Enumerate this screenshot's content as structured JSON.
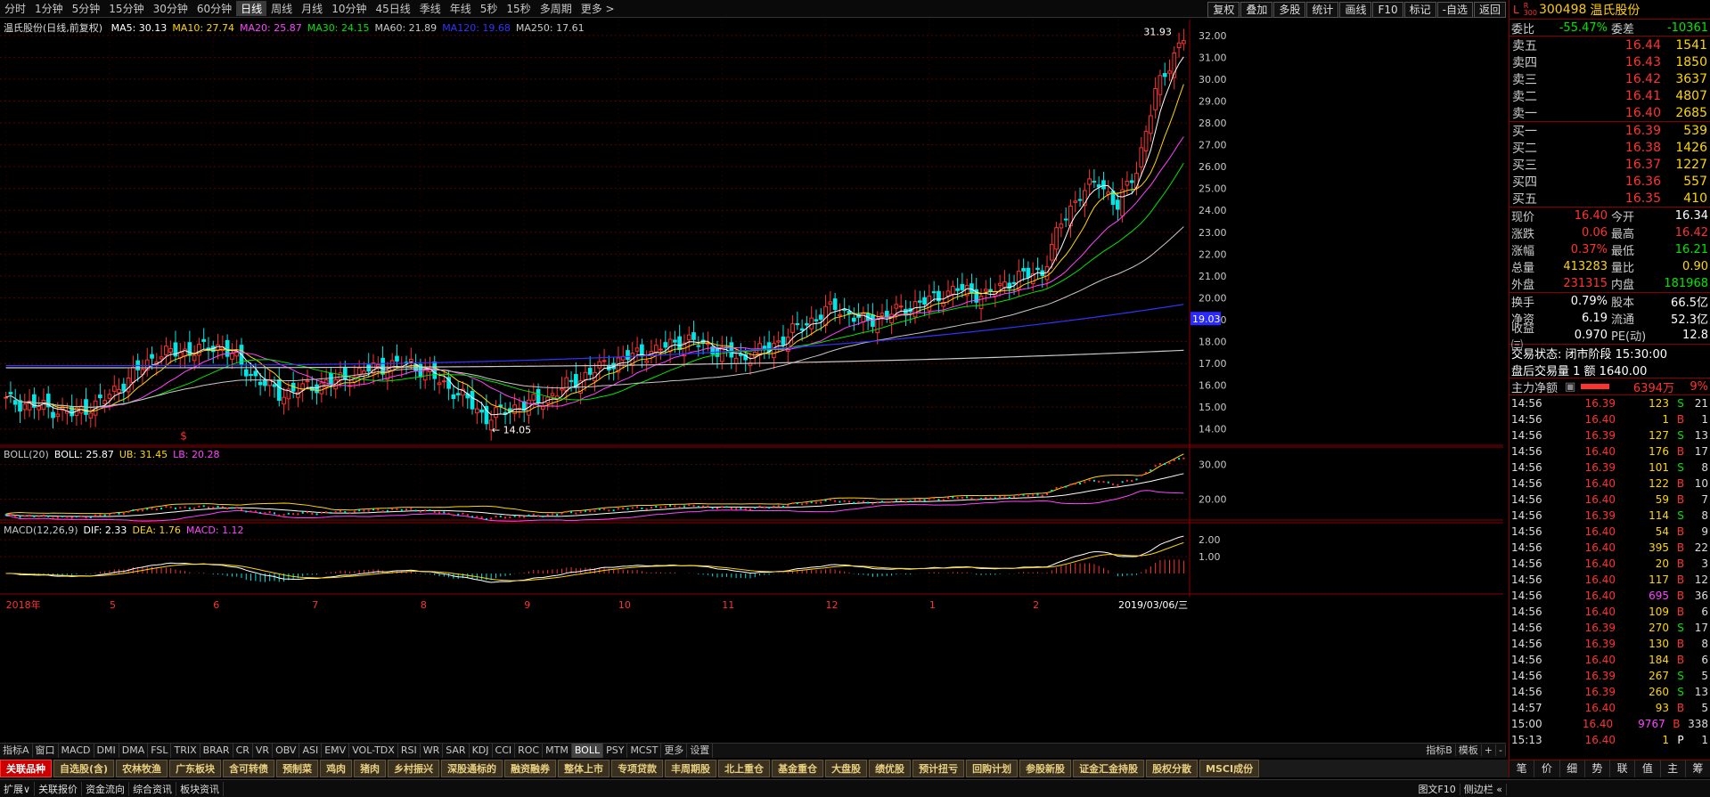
{
  "periods": [
    "分时",
    "1分钟",
    "5分钟",
    "15分钟",
    "30分钟",
    "60分钟",
    "日线",
    "周线",
    "月线",
    "10分钟",
    "45日线",
    "季线",
    "年线",
    "5秒",
    "15秒",
    "多周期",
    "更多 >"
  ],
  "active_period": "日线",
  "toolbar_right": [
    "复权",
    "叠加",
    "多股",
    "统计",
    "画线",
    "F10",
    "标记",
    "-自选",
    "返回"
  ],
  "stock": {
    "code": "300498",
    "name": "温氏股份",
    "market_badge_top": "R",
    "market_badge_bot": "300",
    "side_mark": "L"
  },
  "chart_title": "温氏股份(日线,前复权)",
  "ma_legend": [
    {
      "label": "MA5: 30.13",
      "color": "#ffffff"
    },
    {
      "label": "MA10: 27.74",
      "color": "#ffd700"
    },
    {
      "label": "MA20: 25.87",
      "color": "#ff44ff"
    },
    {
      "label": "MA30: 24.15",
      "color": "#00e600"
    },
    {
      "label": "MA60: 21.89",
      "color": "#c8c8c8"
    },
    {
      "label": "MA120: 19.68",
      "color": "#3333ff"
    },
    {
      "label": "MA250: 17.61",
      "color": "#c8c8c8"
    }
  ],
  "boll_legend": [
    {
      "label": "BOLL(20)",
      "color": "#c8c8c8"
    },
    {
      "label": "BOLL: 25.87",
      "color": "#ffffff"
    },
    {
      "label": "UB: 31.45",
      "color": "#ffd700"
    },
    {
      "label": "LB: 20.28",
      "color": "#ff44ff"
    }
  ],
  "macd_legend": [
    {
      "label": "MACD(12,26,9)",
      "color": "#c8c8c8"
    },
    {
      "label": "DIF: 2.33",
      "color": "#ffffff"
    },
    {
      "label": "DEA: 1.76",
      "color": "#ffd700"
    },
    {
      "label": "MACD: 1.12",
      "color": "#ff44ff"
    }
  ],
  "chart_data": {
    "type": "candlestick",
    "price_ticks": [
      "32.00",
      "31.00",
      "30.00",
      "29.00",
      "28.00",
      "27.00",
      "26.00",
      "25.00",
      "24.00",
      "23.00",
      "22.00",
      "21.00",
      "20.00",
      "19.00",
      "18.00",
      "17.00",
      "16.00",
      "15.00",
      "14.00"
    ],
    "price_ylim": [
      13.5,
      32.4
    ],
    "boll_ticks": [
      "30.00",
      "20.00"
    ],
    "boll_ylim": [
      15,
      34
    ],
    "macd_ticks": [
      "2.00",
      "1.00"
    ],
    "macd_ylim": [
      -1.0,
      2.8
    ],
    "x_labels": [
      "2018年",
      "5",
      "6",
      "7",
      "8",
      "9",
      "10",
      "11",
      "12",
      "1",
      "2",
      "2019/03/06/三"
    ],
    "x_label_bar_index": [
      0,
      22,
      44,
      65,
      88,
      110,
      130,
      152,
      174,
      196,
      218,
      240
    ],
    "annotations": {
      "high": "31.93",
      "low": "14.05",
      "marker": "19.03",
      "flag": "$"
    },
    "anchors": [
      [
        0,
        15.3
      ],
      [
        8,
        15.0
      ],
      [
        14,
        14.7
      ],
      [
        20,
        15.2
      ],
      [
        26,
        16.3
      ],
      [
        32,
        17.4
      ],
      [
        40,
        17.6
      ],
      [
        46,
        17.8
      ],
      [
        52,
        16.5
      ],
      [
        58,
        15.6
      ],
      [
        64,
        15.9
      ],
      [
        72,
        16.3
      ],
      [
        78,
        16.8
      ],
      [
        86,
        17.0
      ],
      [
        92,
        16.2
      ],
      [
        98,
        15.3
      ],
      [
        102,
        14.5
      ],
      [
        108,
        15.0
      ],
      [
        114,
        15.3
      ],
      [
        120,
        16.1
      ],
      [
        126,
        16.8
      ],
      [
        132,
        17.3
      ],
      [
        138,
        17.6
      ],
      [
        144,
        18.1
      ],
      [
        150,
        17.7
      ],
      [
        156,
        17.2
      ],
      [
        162,
        17.7
      ],
      [
        168,
        18.6
      ],
      [
        176,
        19.6
      ],
      [
        182,
        18.9
      ],
      [
        188,
        19.3
      ],
      [
        196,
        19.9
      ],
      [
        202,
        20.4
      ],
      [
        208,
        20.1
      ],
      [
        214,
        20.9
      ],
      [
        220,
        21.2
      ],
      [
        224,
        23.4
      ],
      [
        228,
        24.8
      ],
      [
        232,
        25.3
      ],
      [
        236,
        24.2
      ],
      [
        240,
        25.9
      ],
      [
        244,
        29.4
      ],
      [
        246,
        30.2
      ],
      [
        248,
        31.2
      ],
      [
        250,
        31.9
      ]
    ],
    "ma120_start": 16.9,
    "ma120_end": 19.7,
    "ma250_start": 16.8,
    "ma250_end": 17.6
  },
  "panel_markers": {
    "low_price": "14.05",
    "high_price": "31.93"
  },
  "indicator_tabs": [
    "指标A",
    "窗口",
    "MACD",
    "DMI",
    "DMA",
    "FSL",
    "TRIX",
    "BRAR",
    "CR",
    "VR",
    "OBV",
    "ASI",
    "EMV",
    "VOL-TDX",
    "RSI",
    "WR",
    "SAR",
    "KDJ",
    "CCI",
    "ROC",
    "MTM",
    "BOLL",
    "PSY",
    "MCST",
    "更多",
    "设置"
  ],
  "active_indicator": "BOLL",
  "indicator_right": [
    "指标B",
    "模板",
    "+",
    "-"
  ],
  "sectors": [
    "关联品种",
    "自选股(含)",
    "农林牧渔",
    "广东板块",
    "含可转债",
    "预制菜",
    "鸡肉",
    "猪肉",
    "乡村振兴",
    "深股通标的",
    "融资融券",
    "整体上市",
    "专项贷款",
    "丰周期股",
    "北上重仓",
    "基金重仓",
    "大盘股",
    "绩优股",
    "预计扭亏",
    "回购计划",
    "参股新股",
    "证金汇金持股",
    "股权分散",
    "MSCI成份"
  ],
  "status_bar": [
    "扩展∨",
    "关联报价",
    "资金流向",
    "综合资讯",
    "板块资讯"
  ],
  "status_right": [
    "图文F10",
    "侧边栏 «"
  ],
  "quote": {
    "weibi": {
      "label": "委比",
      "value": "-55.47%",
      "label2": "委差",
      "value2": "-10361"
    },
    "sells": [
      {
        "label": "卖五",
        "price": "16.44",
        "vol": "1541"
      },
      {
        "label": "卖四",
        "price": "16.43",
        "vol": "1850"
      },
      {
        "label": "卖三",
        "price": "16.42",
        "vol": "3637"
      },
      {
        "label": "卖二",
        "price": "16.41",
        "vol": "4807"
      },
      {
        "label": "卖一",
        "price": "16.40",
        "vol": "2685"
      }
    ],
    "buys": [
      {
        "label": "买一",
        "price": "16.39",
        "vol": "539"
      },
      {
        "label": "买二",
        "price": "16.38",
        "vol": "1426"
      },
      {
        "label": "买三",
        "price": "16.37",
        "vol": "1227"
      },
      {
        "label": "买四",
        "price": "16.36",
        "vol": "557"
      },
      {
        "label": "买五",
        "price": "16.35",
        "vol": "410"
      }
    ],
    "stats": [
      {
        "k": "现价",
        "v": "16.40",
        "vc": "red",
        "k2": "今开",
        "v2": "16.34",
        "v2c": "wht"
      },
      {
        "k": "涨跌",
        "v": "0.06",
        "vc": "red",
        "k2": "最高",
        "v2": "16.42",
        "v2c": "red"
      },
      {
        "k": "涨幅",
        "v": "0.37%",
        "vc": "red",
        "k2": "最低",
        "v2": "16.21",
        "v2c": "grn"
      },
      {
        "k": "总量",
        "v": "413283",
        "vc": "yel",
        "k2": "量比",
        "v2": "0.90",
        "v2c": "yel"
      },
      {
        "k": "外盘",
        "v": "231315",
        "vc": "red",
        "k2": "内盘",
        "v2": "181968",
        "v2c": "grn"
      }
    ],
    "stats2": [
      {
        "k": "换手",
        "v": "0.79%",
        "k2": "股本",
        "v2": "66.5亿"
      },
      {
        "k": "净资",
        "v": "6.19",
        "k2": "流通",
        "v2": "52.3亿"
      },
      {
        "k": "收益㈢",
        "v": "0.970",
        "k2": "PE(动)",
        "v2": "12.8"
      }
    ],
    "trade_state": "交易状态: 闭市阶段 15:30:00",
    "after_hours": "盘后交易量 1 额 1640.00",
    "main_flow": {
      "label": "主力净额",
      "value": "6394万",
      "pct": "9%"
    }
  },
  "ticks": [
    {
      "t": "14:56",
      "p": "16.39",
      "q": "123",
      "s": "S",
      "n": "21"
    },
    {
      "t": "14:56",
      "p": "16.40",
      "q": "1",
      "s": "B",
      "n": "1"
    },
    {
      "t": "14:56",
      "p": "16.39",
      "q": "127",
      "s": "S",
      "n": "13"
    },
    {
      "t": "14:56",
      "p": "16.40",
      "q": "176",
      "s": "B",
      "n": "17"
    },
    {
      "t": "14:56",
      "p": "16.39",
      "q": "101",
      "s": "S",
      "n": "8"
    },
    {
      "t": "14:56",
      "p": "16.40",
      "q": "122",
      "s": "B",
      "n": "10"
    },
    {
      "t": "14:56",
      "p": "16.40",
      "q": "59",
      "s": "B",
      "n": "7"
    },
    {
      "t": "14:56",
      "p": "16.39",
      "q": "114",
      "s": "S",
      "n": "8"
    },
    {
      "t": "14:56",
      "p": "16.40",
      "q": "54",
      "s": "B",
      "n": "9"
    },
    {
      "t": "14:56",
      "p": "16.40",
      "q": "395",
      "s": "B",
      "n": "22"
    },
    {
      "t": "14:56",
      "p": "16.40",
      "q": "20",
      "s": "B",
      "n": "3"
    },
    {
      "t": "14:56",
      "p": "16.40",
      "q": "117",
      "s": "B",
      "n": "12"
    },
    {
      "t": "14:56",
      "p": "16.40",
      "q": "695",
      "s": "B",
      "n": "36"
    },
    {
      "t": "14:56",
      "p": "16.40",
      "q": "109",
      "s": "B",
      "n": "6"
    },
    {
      "t": "14:56",
      "p": "16.39",
      "q": "270",
      "s": "S",
      "n": "17"
    },
    {
      "t": "14:56",
      "p": "16.39",
      "q": "130",
      "s": "B",
      "n": "8"
    },
    {
      "t": "14:56",
      "p": "16.40",
      "q": "184",
      "s": "B",
      "n": "6"
    },
    {
      "t": "14:56",
      "p": "16.39",
      "q": "267",
      "s": "S",
      "n": "5"
    },
    {
      "t": "14:56",
      "p": "16.39",
      "q": "260",
      "s": "S",
      "n": "13"
    },
    {
      "t": "14:57",
      "p": "16.40",
      "q": "93",
      "s": "B",
      "n": "5"
    },
    {
      "t": "15:00",
      "p": "16.40",
      "q": "9767",
      "s": "B",
      "n": "338"
    },
    {
      "t": "15:13",
      "p": "16.40",
      "q": "1",
      "s": "P",
      "n": "1"
    }
  ],
  "right_tabs": [
    "笔",
    "价",
    "细",
    "势",
    "联",
    "值",
    "主",
    "筹"
  ]
}
